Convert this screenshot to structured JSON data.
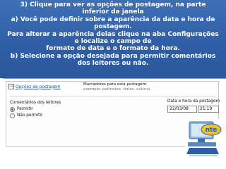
{
  "instructions": {
    "lines": [
      "3) Clique para ver as opções de postagem, na parte",
      "inferior da janela",
      "a) Você pode definir sobre a aparência da data e hora de",
      "postagem.",
      "Para alterar a aparência delas clique na aba Configurações",
      "e localize o campo de",
      "formato de data e o formato da hora.",
      "b) Selecione a opção desejada para permitir comentários",
      "dos leitores ou não."
    ]
  },
  "options_link": "Opções de postagem",
  "labels_box": {
    "title": "Marcadores para esta postagem:",
    "example": "exemplo, patinetes, férias, outono"
  },
  "comments": {
    "title": "Comentários dos leitores",
    "allow": "Permitir",
    "deny": "Não permitir"
  },
  "datetime": {
    "label": "Data e hora da postagem",
    "date": "22/03/08",
    "time": "21:19"
  },
  "logo": {
    "text": "nte"
  },
  "colors": {
    "banner": "#2f5ea6",
    "logo_accent": "#1d5fb8"
  }
}
